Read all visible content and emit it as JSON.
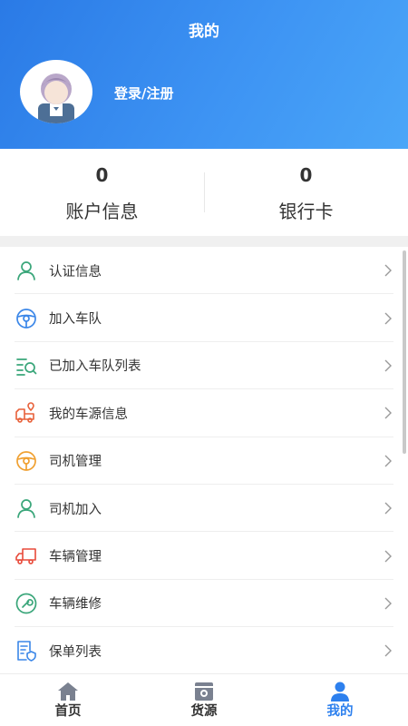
{
  "header": {
    "title": "我的",
    "login_label": "登录/注册"
  },
  "stats": [
    {
      "value": "0",
      "label": "账户信息"
    },
    {
      "value": "0",
      "label": "银行卡"
    }
  ],
  "menu": {
    "items": [
      {
        "label": "认证信息",
        "icon": "person-outline-icon",
        "color": "#3aa67a"
      },
      {
        "label": "加入车队",
        "icon": "steering-wheel-icon",
        "color": "#3a86e8"
      },
      {
        "label": "已加入车队列表",
        "icon": "list-search-icon",
        "color": "#3aa67a"
      },
      {
        "label": "我的车源信息",
        "icon": "truck-location-icon",
        "color": "#e8613a"
      },
      {
        "label": "司机管理",
        "icon": "steering-wheel-icon",
        "color": "#f0a030"
      },
      {
        "label": "司机加入",
        "icon": "person-outline-icon",
        "color": "#3aa67a"
      },
      {
        "label": "车辆管理",
        "icon": "truck-icon",
        "color": "#e84a3a"
      },
      {
        "label": "车辆维修",
        "icon": "wrench-icon",
        "color": "#3aa67a"
      },
      {
        "label": "保单列表",
        "icon": "document-shield-icon",
        "color": "#3a86e8"
      }
    ]
  },
  "tabbar": {
    "tabs": [
      {
        "label": "首页",
        "icon": "home-icon"
      },
      {
        "label": "货源",
        "icon": "cargo-icon"
      },
      {
        "label": "我的",
        "icon": "user-icon",
        "active": true
      }
    ]
  },
  "colors": {
    "accent": "#2d80ee",
    "header_start": "#2a7ae6",
    "header_end": "#4aa6f8"
  }
}
